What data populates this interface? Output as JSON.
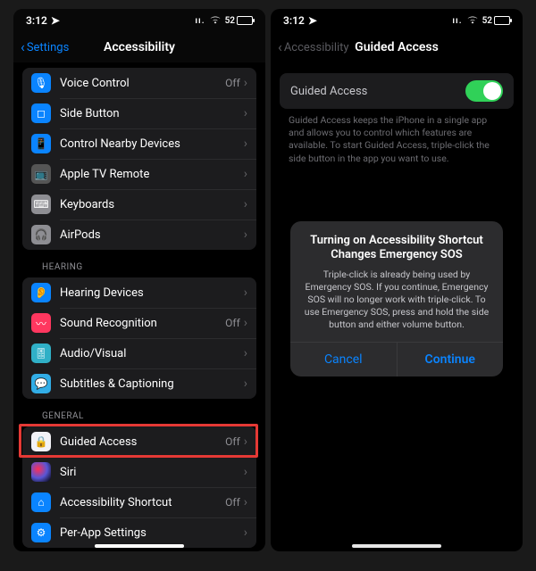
{
  "statusbar": {
    "time": "3:12",
    "location_glyph": "➤",
    "signal_glyph": "ıı.",
    "wifi_glyph": "▾",
    "battery_pct": "52"
  },
  "phone1": {
    "back_label": "Settings",
    "title": "Accessibility",
    "groups": [
      {
        "rows": [
          {
            "icon_bg": "bg-blue",
            "icon_glyph": "🎙",
            "label": "Voice Control",
            "status": "Off"
          },
          {
            "icon_bg": "bg-blue",
            "icon_glyph": "◻",
            "label": "Side Button",
            "status": ""
          },
          {
            "icon_bg": "bg-blue",
            "icon_glyph": "📱",
            "label": "Control Nearby Devices",
            "status": ""
          },
          {
            "icon_bg": "bg-dkgray",
            "icon_glyph": "📺",
            "label": "Apple TV Remote",
            "status": ""
          },
          {
            "icon_bg": "bg-gray",
            "icon_glyph": "⌨",
            "label": "Keyboards",
            "status": ""
          },
          {
            "icon_bg": "bg-gray",
            "icon_glyph": "🎧",
            "label": "AirPods",
            "status": ""
          }
        ]
      },
      {
        "header": "HEARING",
        "rows": [
          {
            "icon_bg": "bg-blue",
            "icon_glyph": "👂",
            "label": "Hearing Devices",
            "status": ""
          },
          {
            "icon_bg": "bg-red",
            "icon_glyph": "〰",
            "label": "Sound Recognition",
            "status": "Off"
          },
          {
            "icon_bg": "bg-teal",
            "icon_glyph": "🎚",
            "label": "Audio/Visual",
            "status": ""
          },
          {
            "icon_bg": "bg-cyan",
            "icon_glyph": "💬",
            "label": "Subtitles & Captioning",
            "status": ""
          }
        ]
      },
      {
        "header": "GENERAL",
        "rows": [
          {
            "icon_bg": "bg-white",
            "icon_glyph": "🔒",
            "label": "Guided Access",
            "status": "Off",
            "highlighted": true
          },
          {
            "icon_bg": "bg-siri",
            "icon_glyph": "",
            "label": "Siri",
            "status": ""
          },
          {
            "icon_bg": "bg-blue",
            "icon_glyph": "⌂",
            "label": "Accessibility Shortcut",
            "status": "Off"
          },
          {
            "icon_bg": "bg-blue",
            "icon_glyph": "⚙",
            "label": "Per-App Settings",
            "status": ""
          }
        ]
      }
    ]
  },
  "phone2": {
    "back_label": "Accessibility",
    "title": "Guided Access",
    "switch_label": "Guided Access",
    "switch_on": true,
    "help_text": "Guided Access keeps the iPhone in a single app and allows you to control which features are available. To start Guided Access, triple-click the side button in the app you want to use.",
    "alert": {
      "title": "Turning on Accessibility Shortcut Changes Emergency SOS",
      "message": "Triple-click is already being used by Emergency SOS. If you continue, Emergency SOS will no longer work with triple-click. To use Emergency SOS, press and hold the side button and either volume button.",
      "cancel": "Cancel",
      "continue": "Continue"
    }
  },
  "chevron_right": "›",
  "chevron_left": "‹"
}
